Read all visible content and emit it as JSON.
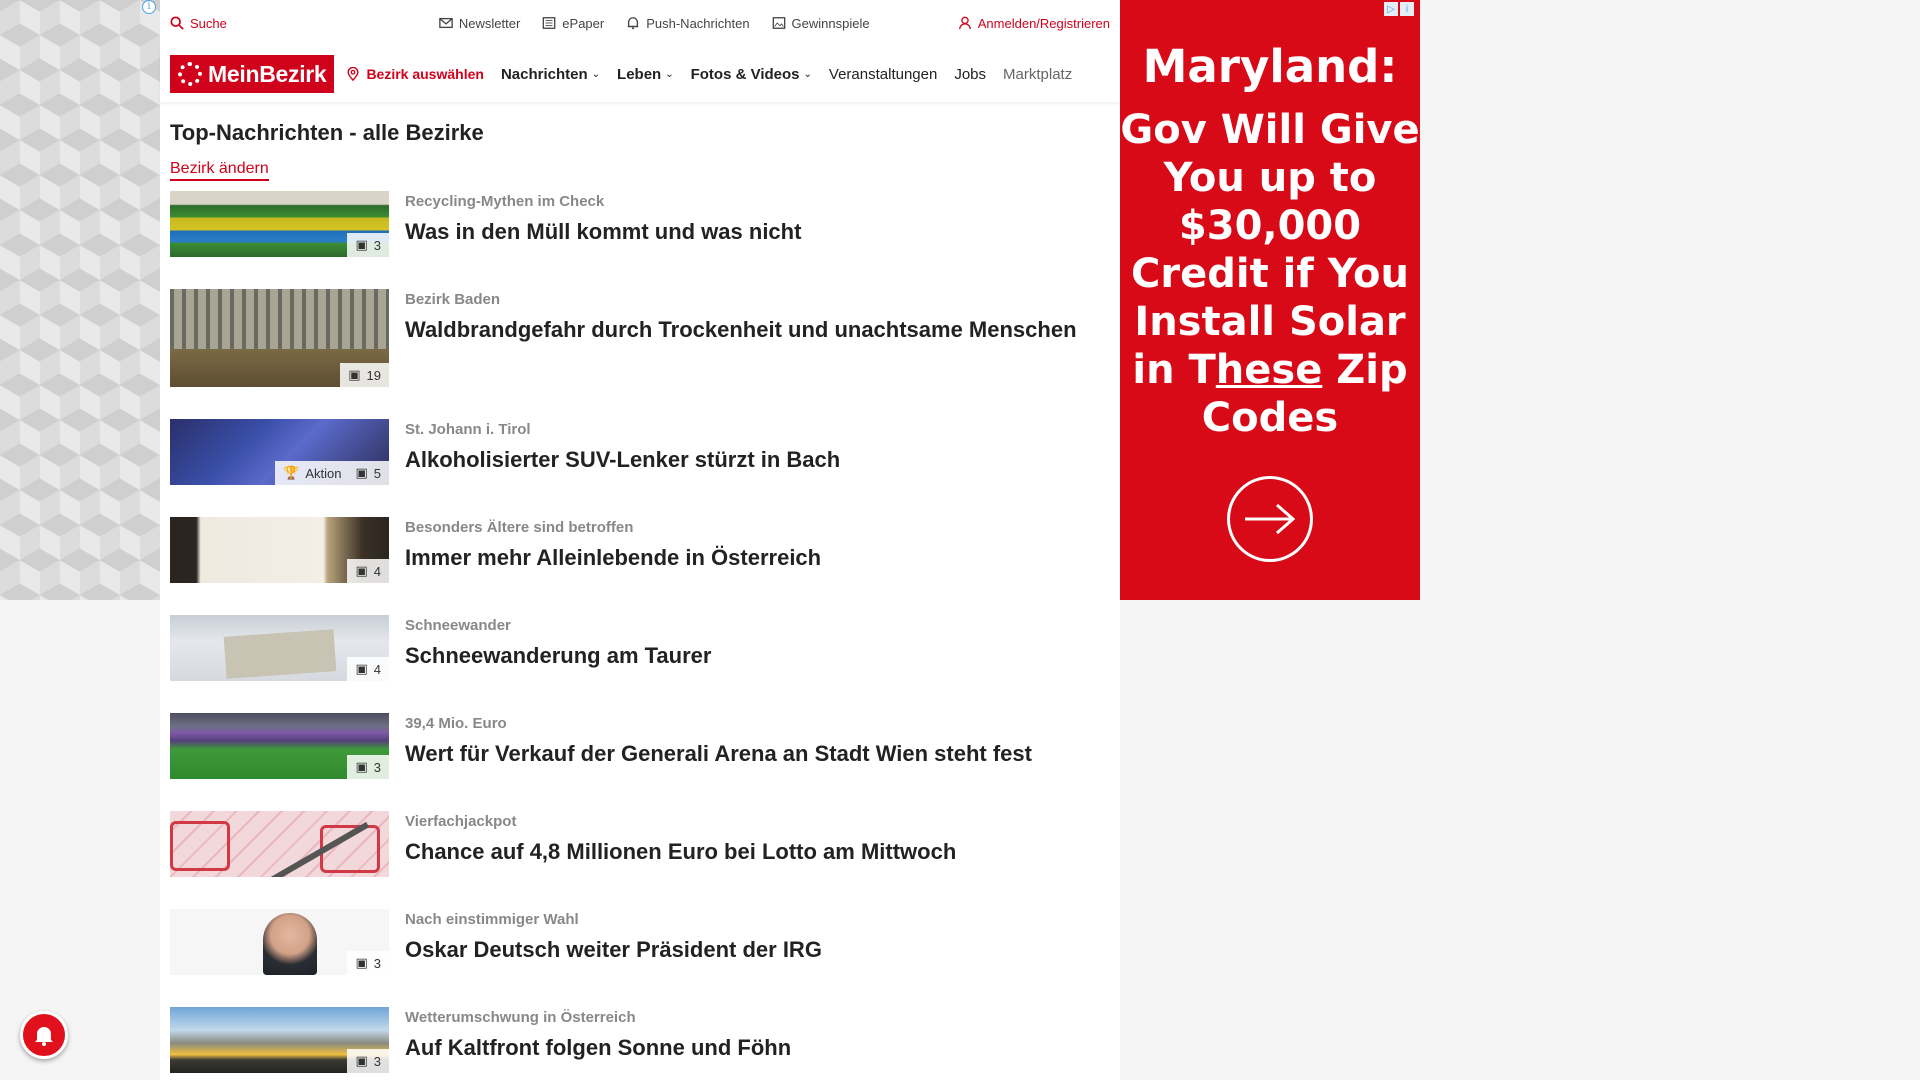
{
  "topbar": {
    "search": "Suche",
    "newsletter": "Newsletter",
    "epaper": "ePaper",
    "push": "Push-Nachrichten",
    "contests": "Gewinnspiele",
    "login": "Anmelden/Registrieren"
  },
  "nav": {
    "logo": "MeinBezirk",
    "district": "Bezirk auswählen",
    "items": [
      {
        "label": "Nachrichten",
        "dropdown": true
      },
      {
        "label": "Leben",
        "dropdown": true
      },
      {
        "label": "Fotos & Videos",
        "dropdown": true
      },
      {
        "label": "Veranstaltungen",
        "dropdown": false
      },
      {
        "label": "Jobs",
        "dropdown": false
      },
      {
        "label": "Marktplatz",
        "dropdown": false
      }
    ]
  },
  "page": {
    "title": "Top-Nachrichten - alle Bezirke",
    "change_link": "Bezirk ändern"
  },
  "articles": [
    {
      "kicker": "Recycling-Mythen im Check",
      "headline": "Was in den Müll kommt und was nicht",
      "images": "3"
    },
    {
      "kicker": "Bezirk Baden",
      "headline": "Waldbrandgefahr durch Trockenheit und unachtsame Menschen",
      "images": "19"
    },
    {
      "kicker": "St. Johann i. Tirol",
      "headline": "Alkoholisierter SUV-Lenker stürzt in Bach",
      "images": "5",
      "action": "Aktion"
    },
    {
      "kicker": "Besonders Ältere sind betroffen",
      "headline": "Immer mehr Alleinlebende in Österreich",
      "images": "4"
    },
    {
      "kicker": "Schneewander",
      "headline": "Schneewanderung am Taurer",
      "images": "4"
    },
    {
      "kicker": "39,4 Mio. Euro",
      "headline": "Wert für Verkauf der Generali Arena an Stadt Wien steht fest",
      "images": "3"
    },
    {
      "kicker": "Vierfachjackpot",
      "headline": "Chance auf 4,8 Millionen Euro bei Lotto am Mittwoch",
      "images": ""
    },
    {
      "kicker": "Nach einstimmiger Wahl",
      "headline": "Oskar Deutsch weiter Präsident der IRG",
      "images": "3"
    },
    {
      "kicker": "Wetterumschwung in Österreich",
      "headline": "Auf Kaltfront folgen Sonne und Föhn",
      "images": "3"
    }
  ],
  "ad": {
    "headline": "Maryland:",
    "line1": "Gov Will Give",
    "line2": "You up to",
    "line3": "$30,000",
    "line4": "Credit if You",
    "line5": "Install Solar",
    "line6a": "in T",
    "line6b": "hese",
    "line6c": " Zip",
    "line7": "Codes",
    "accent_color": "#d80a18"
  },
  "colors": {
    "brand": "#d0021b"
  },
  "icons": {
    "search": "search-icon",
    "newsletter": "mail-icon",
    "epaper": "newspaper-icon",
    "push": "bell-icon",
    "contests": "gift-icon",
    "login": "user-icon",
    "district": "location-pin-icon"
  }
}
